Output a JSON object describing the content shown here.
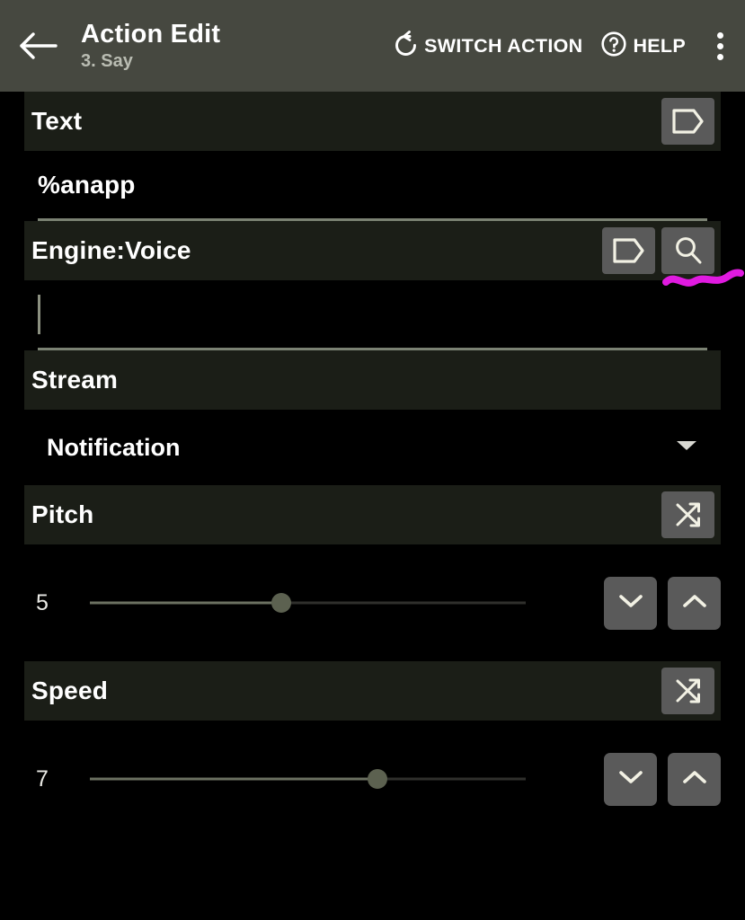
{
  "appbar": {
    "back_icon": "arrow-left-icon",
    "title": "Action Edit",
    "subtitle": "3. Say",
    "switch_action_label": "SWITCH ACTION",
    "switch_action_icon": "undo-rotate-icon",
    "help_label": "HELP",
    "help_icon": "question-circle-icon",
    "overflow_icon": "overflow-menu-icon",
    "background_color": "#464840"
  },
  "colors": {
    "page_background": "#000000",
    "section_header_background": "#1b1e17",
    "icon_button_background": "#5a5a5a",
    "icon_glyph": "#f2f1e4",
    "slider_fill": "#6b7161",
    "slider_track": "#2f2f2c",
    "slider_thumb": "#5c6150",
    "underline": "#7b8273",
    "annotation": "#e01ae0"
  },
  "sections": {
    "text": {
      "title": "Text",
      "tag_icon": "tag-icon",
      "value": "%anapp"
    },
    "engine_voice": {
      "title": "Engine:Voice",
      "tag_icon": "tag-icon",
      "search_icon": "search-icon",
      "value": "",
      "has_caret": true
    },
    "stream": {
      "title": "Stream",
      "selected": "Notification",
      "dropdown_icon": "chevron-down-icon"
    },
    "pitch": {
      "title": "Pitch",
      "shuffle_icon": "shuffle-icon",
      "value": "5",
      "percent": 44,
      "decrement_icon": "chevron-down-icon",
      "increment_icon": "chevron-up-icon"
    },
    "speed": {
      "title": "Speed",
      "shuffle_icon": "shuffle-icon",
      "value": "7",
      "percent": 66,
      "decrement_icon": "chevron-down-icon",
      "increment_icon": "chevron-up-icon"
    }
  },
  "annotation": {
    "type": "hand-drawn-squiggle-underline",
    "color": "#e01ae0",
    "target": "engine-voice-search-button"
  }
}
